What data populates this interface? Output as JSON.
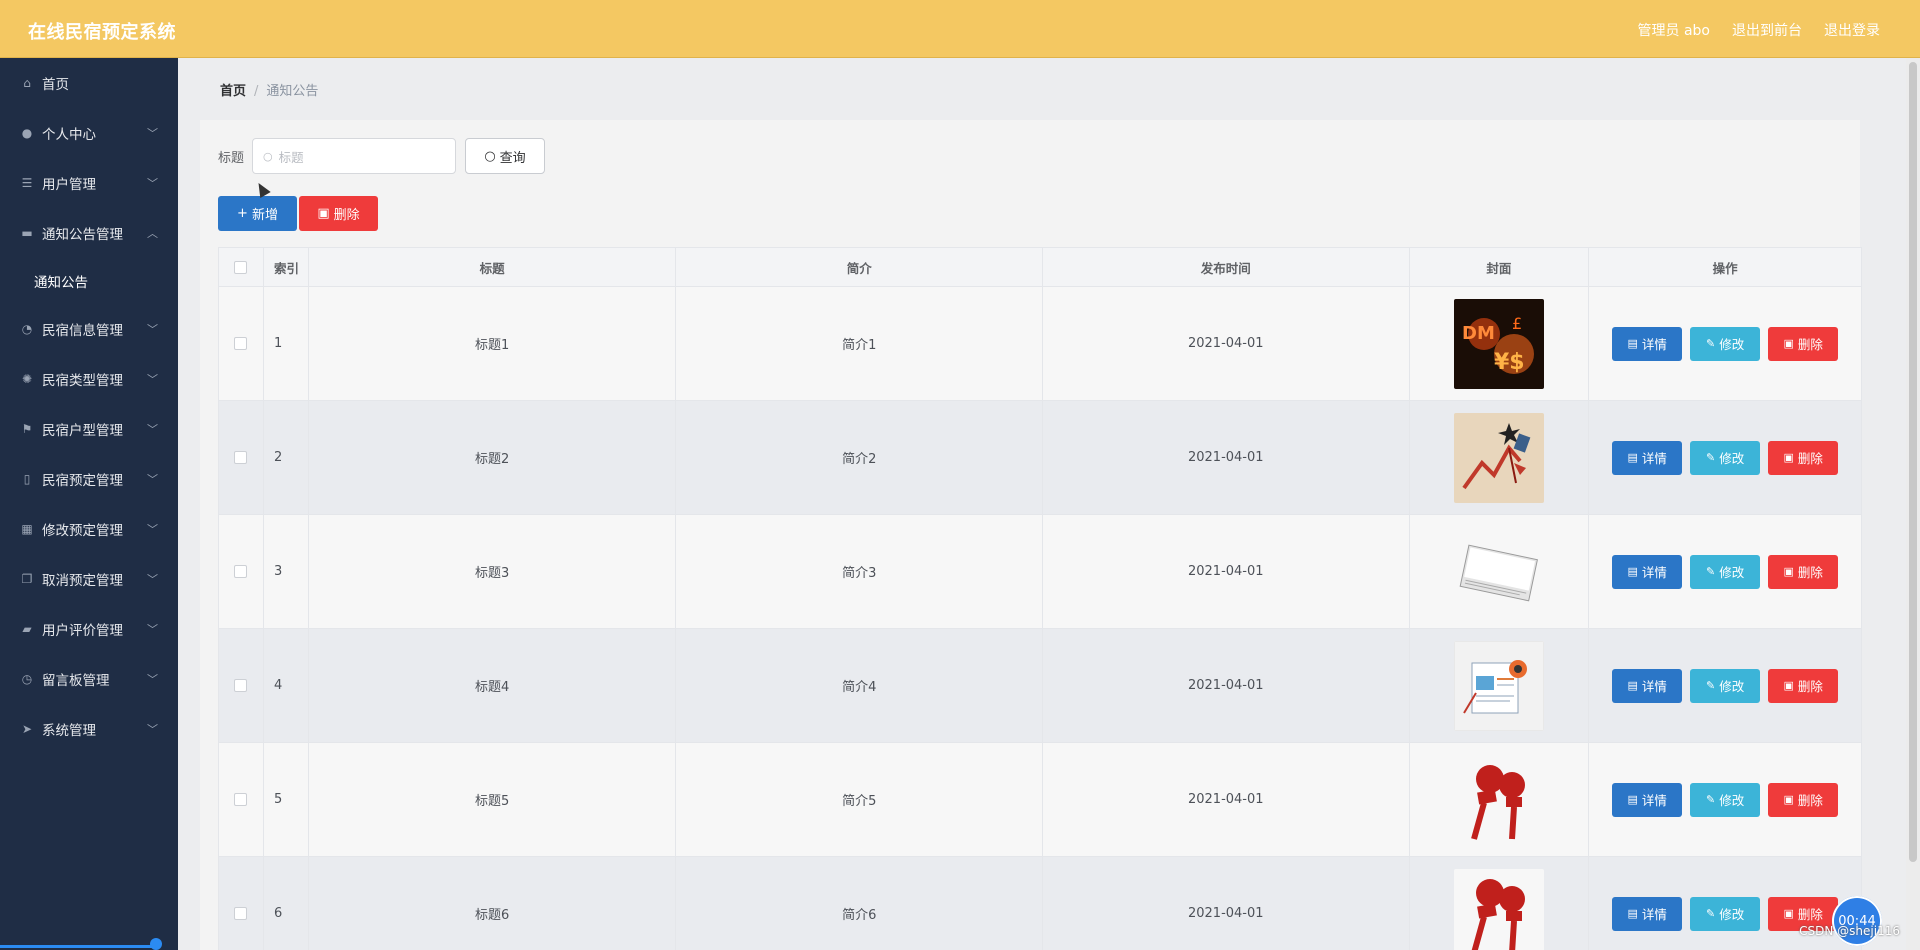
{
  "app": {
    "title": "在线民宿预定系统",
    "admin_label": "管理员 abo",
    "front_label": "退出到前台",
    "logout_label": "退出登录"
  },
  "sidebar": {
    "items": [
      {
        "label": "首页",
        "icon": "home-icon"
      },
      {
        "label": "个人中心",
        "icon": "user-icon"
      },
      {
        "label": "用户管理",
        "icon": "list-icon"
      },
      {
        "label": "通知公告管理",
        "icon": "briefcase-icon"
      },
      {
        "label": "民宿信息管理",
        "icon": "gauge-icon"
      },
      {
        "label": "民宿类型管理",
        "icon": "dial-icon"
      },
      {
        "label": "民宿户型管理",
        "icon": "flag-icon"
      },
      {
        "label": "民宿预定管理",
        "icon": "mic-icon"
      },
      {
        "label": "修改预定管理",
        "icon": "grid-icon"
      },
      {
        "label": "取消预定管理",
        "icon": "copy-icon"
      },
      {
        "label": "用户评价管理",
        "icon": "ticket-icon"
      },
      {
        "label": "留言板管理",
        "icon": "compass-icon"
      },
      {
        "label": "系统管理",
        "icon": "send-icon"
      }
    ],
    "sub_item": "通知公告"
  },
  "breadcrumb": {
    "home": "首页",
    "current": "通知公告"
  },
  "search": {
    "label": "标题",
    "placeholder": "标题",
    "button": "查询"
  },
  "actions": {
    "add": "新增",
    "delete": "删除"
  },
  "table": {
    "headers": [
      "索引",
      "标题",
      "简介",
      "发布时间",
      "封面",
      "操作"
    ],
    "rows": [
      {
        "index": "1",
        "title": "标题1",
        "brief": "简介1",
        "time": "2021-04-01"
      },
      {
        "index": "2",
        "title": "标题2",
        "brief": "简介2",
        "time": "2021-04-01"
      },
      {
        "index": "3",
        "title": "标题3",
        "brief": "简介3",
        "time": "2021-04-01"
      },
      {
        "index": "4",
        "title": "标题4",
        "brief": "简介4",
        "time": "2021-04-01"
      },
      {
        "index": "5",
        "title": "标题5",
        "brief": "简介5",
        "time": "2021-04-01"
      },
      {
        "index": "6",
        "title": "标题6",
        "brief": "简介6",
        "time": "2021-04-01"
      }
    ],
    "row_ops": {
      "detail": "详情",
      "edit": "修改",
      "delete": "删除"
    }
  },
  "overlay": {
    "timer": "00:44",
    "watermark": "CSDN @sheji116"
  },
  "colors": {
    "topbar": "#f4c862",
    "sidebar": "#1f2d45",
    "primary": "#2b76c7",
    "danger": "#ef3b3b",
    "info": "#3cb4d8"
  }
}
